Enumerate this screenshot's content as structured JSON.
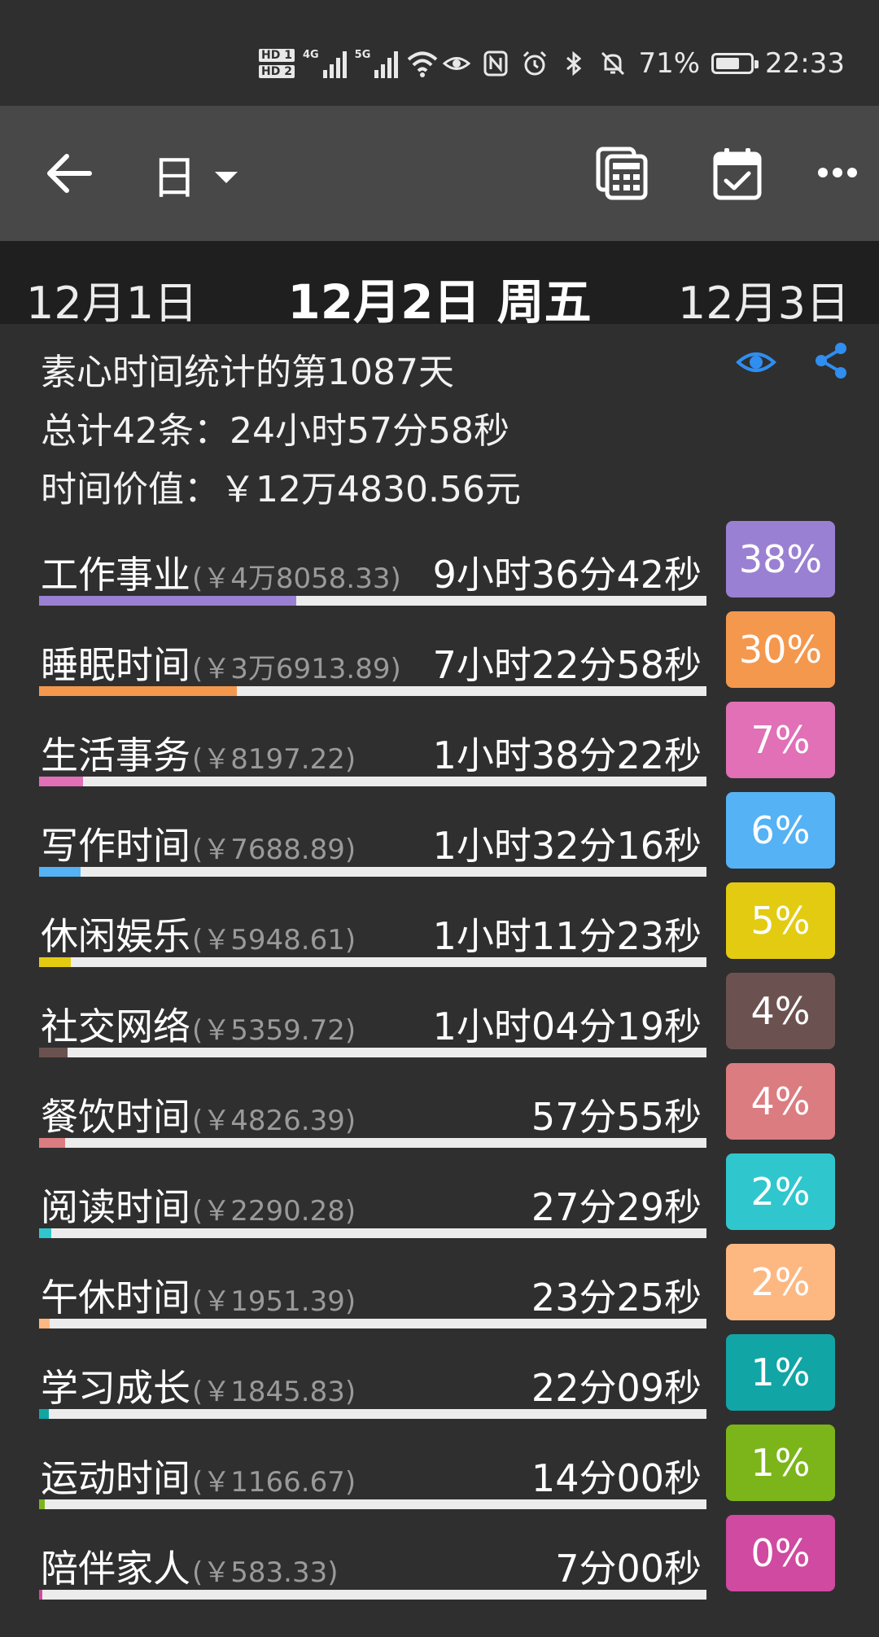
{
  "status_bar": {
    "hd1": "HD 1",
    "hd2": "HD 2",
    "net1": "4G",
    "net2": "5G",
    "battery_pct": "71%",
    "time": "22:33"
  },
  "toolbar": {
    "mode_label": "日"
  },
  "date_nav": {
    "prev": "12月1日",
    "current": "12月2日 周五",
    "next": "12月3日"
  },
  "summary": {
    "line1": "素心时间统计的第1087天",
    "line2": "总计42条：24小时57分58秒",
    "line3": "时间价值：￥12万4830.56元"
  },
  "categories": [
    {
      "name": "工作事业",
      "money": "(￥4万8058.33)",
      "duration": "9小时36分42秒",
      "percent": "38%",
      "fraction": 0.385,
      "color": "#9a80d2"
    },
    {
      "name": "睡眠时间",
      "money": "(￥3万6913.89)",
      "duration": "7小时22分58秒",
      "percent": "30%",
      "fraction": 0.296,
      "color": "#f4984e"
    },
    {
      "name": "生活事务",
      "money": "(￥8197.22)",
      "duration": "1小时38分22秒",
      "percent": "7%",
      "fraction": 0.066,
      "color": "#e170b6"
    },
    {
      "name": "写作时间",
      "money": "(￥7688.89)",
      "duration": "1小时32分16秒",
      "percent": "6%",
      "fraction": 0.062,
      "color": "#55b2f4"
    },
    {
      "name": "休闲娱乐",
      "money": "(￥5948.61)",
      "duration": "1小时11分23秒",
      "percent": "5%",
      "fraction": 0.048,
      "color": "#e3cb12"
    },
    {
      "name": "社交网络",
      "money": "(￥5359.72)",
      "duration": "1小时04分19秒",
      "percent": "4%",
      "fraction": 0.043,
      "color": "#6b5250"
    },
    {
      "name": "餐饮时间",
      "money": "(￥4826.39)",
      "duration": "57分55秒",
      "percent": "4%",
      "fraction": 0.039,
      "color": "#db7c80"
    },
    {
      "name": "阅读时间",
      "money": "(￥2290.28)",
      "duration": "27分29秒",
      "percent": "2%",
      "fraction": 0.018,
      "color": "#2fc7cd"
    },
    {
      "name": "午休时间",
      "money": "(￥1951.39)",
      "duration": "23分25秒",
      "percent": "2%",
      "fraction": 0.016,
      "color": "#fdb882"
    },
    {
      "name": "学习成长",
      "money": "(￥1845.83)",
      "duration": "22分09秒",
      "percent": "1%",
      "fraction": 0.015,
      "color": "#12a5a5"
    },
    {
      "name": "运动时间",
      "money": "(￥1166.67)",
      "duration": "14分00秒",
      "percent": "1%",
      "fraction": 0.009,
      "color": "#7cb51a"
    },
    {
      "name": "陪伴家人",
      "money": "(￥583.33)",
      "duration": "7分00秒",
      "percent": "0%",
      "fraction": 0.005,
      "color": "#cf4aa0"
    }
  ]
}
